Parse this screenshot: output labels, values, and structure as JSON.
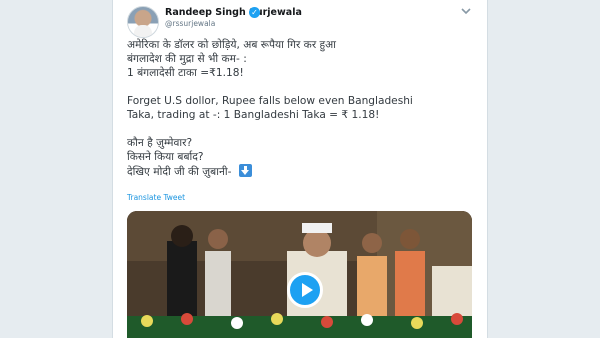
{
  "tweet": {
    "display_name": "Randeep Singh Surjewala",
    "verified_icon": "verified-badge-icon",
    "handle": "@rssurjewala",
    "menu_icon": "chevron-down-icon",
    "text_lines": [
      "अमेरिका के डॉलर को छोड़िये, अब रूपैया गिर कर हुआ",
      "बंगलादेश की मुद्रा से भी कम- :",
      "1 बंगलादेसी टाका =₹1.18!",
      "Forget U.S dollor, Rupee falls below even Bangladeshi",
      "Taka, trading at -: 1 Bangladeshi Taka = ₹ 1.18!",
      "कौन है ज़ुम्मेवार?",
      "किसने किया बर्बाद?",
      "देखिए मोदी जी की ज़ुबानी-"
    ],
    "translate_label": "Translate Tweet",
    "video": {
      "play_icon": "play-icon"
    }
  },
  "colors": {
    "link": "#1b95e0",
    "verified": "#1da1f2",
    "page_bg": "#e6ecf0"
  }
}
